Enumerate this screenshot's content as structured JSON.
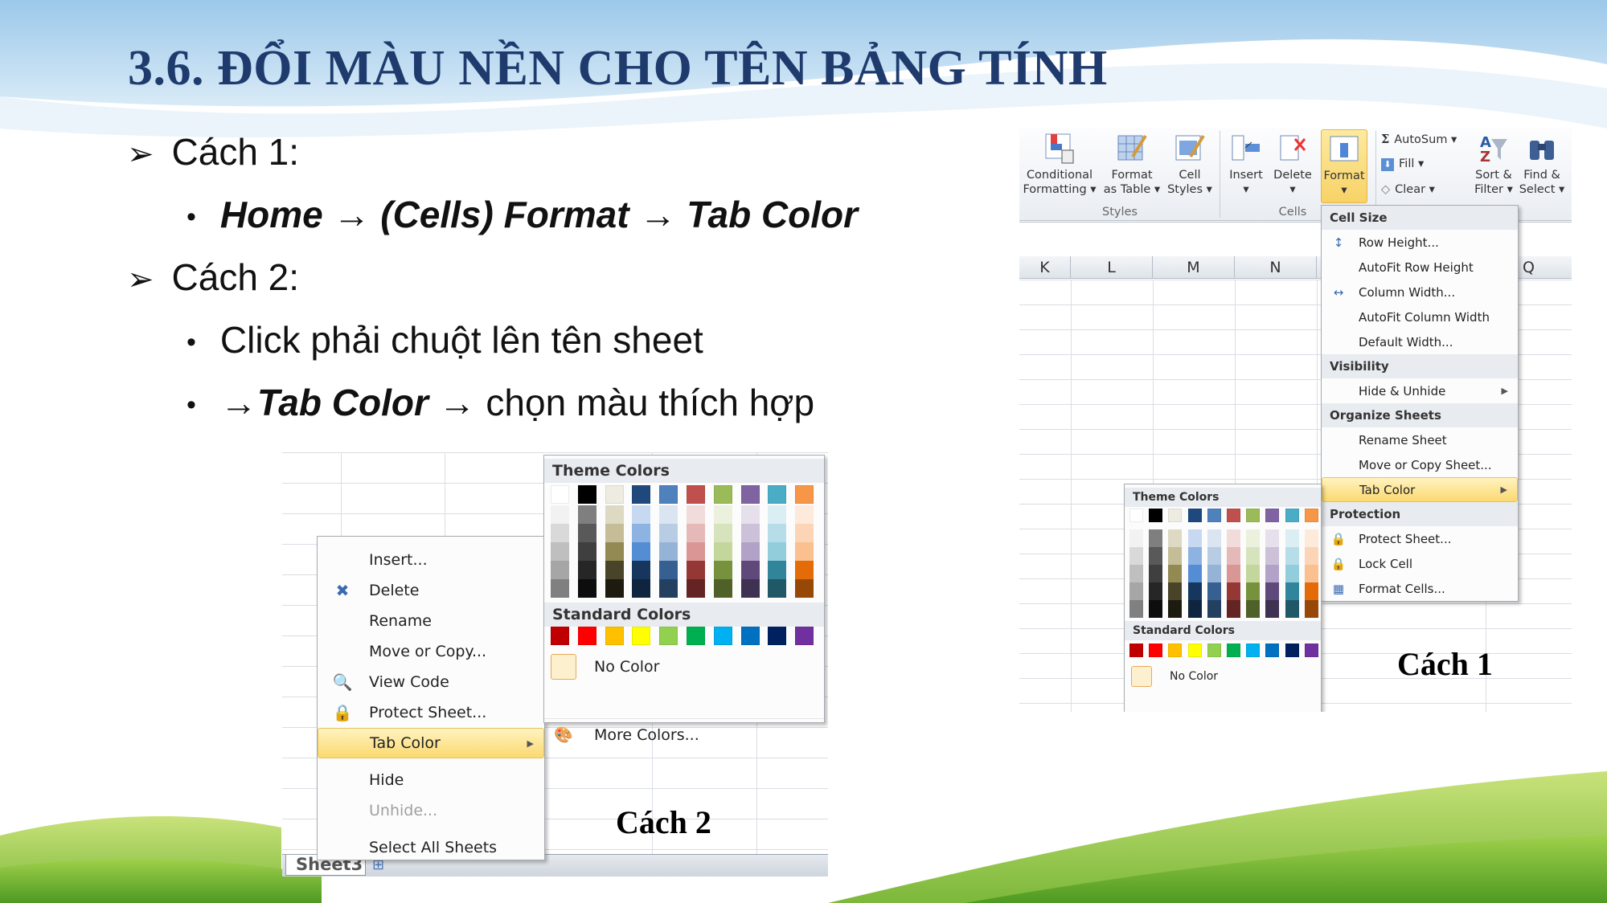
{
  "slide": {
    "title": "3.6. ĐỔI MÀU NỀN CHO TÊN BẢNG TÍNH",
    "method1": "Cách 1:",
    "method1_path": "Home → (Cells) Format → Tab Color",
    "method2": "Cách 2:",
    "method2_step1": "Click phải chuột lên tên sheet",
    "method2_step2_arrow": "→",
    "method2_step2_bold": "Tab Color",
    "method2_step2_rest": "→ chọn màu thích hợp",
    "caption1": "Cách 1",
    "caption2": "Cách 2"
  },
  "ribbon": {
    "conditional": [
      "Conditional",
      "Formatting ▾"
    ],
    "format_table": [
      "Format",
      "as Table ▾"
    ],
    "cell_styles": [
      "Cell",
      "Styles ▾"
    ],
    "styles_group": "Styles",
    "insert": "Insert",
    "delete": "Delete",
    "format": "Format",
    "cells_group": "Cells",
    "autosum": "AutoSum ▾",
    "fill": "Fill ▾",
    "clear": "Clear ▾",
    "sort": [
      "Sort &",
      "Filter ▾"
    ],
    "find": [
      "Find &",
      "Select ▾"
    ],
    "columns": [
      "K",
      "L",
      "M",
      "N",
      "Q"
    ]
  },
  "format_menu": [
    {
      "type": "header",
      "label": "Cell Size"
    },
    {
      "type": "item",
      "label": "Row Height...",
      "icon": "row-height-icon"
    },
    {
      "type": "item",
      "label": "AutoFit Row Height"
    },
    {
      "type": "item",
      "label": "Column Width...",
      "icon": "column-width-icon"
    },
    {
      "type": "item",
      "label": "AutoFit Column Width"
    },
    {
      "type": "item",
      "label": "Default Width..."
    },
    {
      "type": "header",
      "label": "Visibility"
    },
    {
      "type": "item",
      "label": "Hide & Unhide",
      "submenu": true
    },
    {
      "type": "header",
      "label": "Organize Sheets"
    },
    {
      "type": "item",
      "label": "Rename Sheet"
    },
    {
      "type": "item",
      "label": "Move or Copy Sheet..."
    },
    {
      "type": "item",
      "label": "Tab Color",
      "submenu": true,
      "highlighted": true
    },
    {
      "type": "header",
      "label": "Protection"
    },
    {
      "type": "item",
      "label": "Protect Sheet...",
      "icon": "protect-sheet-icon"
    },
    {
      "type": "item",
      "label": "Lock Cell",
      "icon": "lock-icon"
    },
    {
      "type": "item",
      "label": "Format Cells...",
      "icon": "format-cells-icon"
    }
  ],
  "context_menu": [
    {
      "label": "Insert..."
    },
    {
      "label": "Delete",
      "icon": "delete-sheet-icon"
    },
    {
      "label": "Rename"
    },
    {
      "label": "Move or Copy..."
    },
    {
      "label": "View Code",
      "icon": "view-code-icon"
    },
    {
      "label": "Protect Sheet...",
      "icon": "protect-sheet-icon"
    },
    {
      "label": "Tab Color",
      "submenu": true,
      "highlighted": true
    },
    {
      "label": "Hide"
    },
    {
      "label": "Unhide...",
      "disabled": true
    },
    {
      "label": "Select All Sheets"
    }
  ],
  "sheet_tab": "Sheet3",
  "palette": {
    "theme_label": "Theme Colors",
    "standard_label": "Standard Colors",
    "no_color": "No Color",
    "more_colors": "More Colors...",
    "theme": [
      "#FFFFFF",
      "#000000",
      "#EEECE1",
      "#1F497D",
      "#4F81BD",
      "#C0504D",
      "#9BBB59",
      "#8064A2",
      "#4BACC6",
      "#F79646"
    ],
    "shades": [
      [
        "#F2F2F2",
        "#D9D9D9",
        "#BFBFBF",
        "#A6A6A6",
        "#808080"
      ],
      [
        "#7F7F7F",
        "#595959",
        "#3F3F3F",
        "#262626",
        "#0D0D0D"
      ],
      [
        "#DDD9C3",
        "#C4BD97",
        "#938953",
        "#494429",
        "#1D1B10"
      ],
      [
        "#C6D9F0",
        "#8DB3E2",
        "#548DD4",
        "#17365D",
        "#0F243E"
      ],
      [
        "#DBE5F1",
        "#B8CCE4",
        "#95B3D7",
        "#366092",
        "#244061"
      ],
      [
        "#F2DCDB",
        "#E5B9B7",
        "#D99694",
        "#953734",
        "#632423"
      ],
      [
        "#EBF1DD",
        "#D7E3BC",
        "#C3D69B",
        "#76923C",
        "#4F6128"
      ],
      [
        "#E5E0EC",
        "#CCC1D9",
        "#B2A2C7",
        "#5F497A",
        "#3F3151"
      ],
      [
        "#DBEEF3",
        "#B7DDE8",
        "#92CDDC",
        "#31859B",
        "#205867"
      ],
      [
        "#FDEADA",
        "#FBD5B5",
        "#FAC08F",
        "#E36C09",
        "#974806"
      ]
    ],
    "standard": [
      "#C00000",
      "#FF0000",
      "#FFC000",
      "#FFFF00",
      "#92D050",
      "#00B050",
      "#00B0F0",
      "#0070C0",
      "#002060",
      "#7030A0"
    ]
  }
}
